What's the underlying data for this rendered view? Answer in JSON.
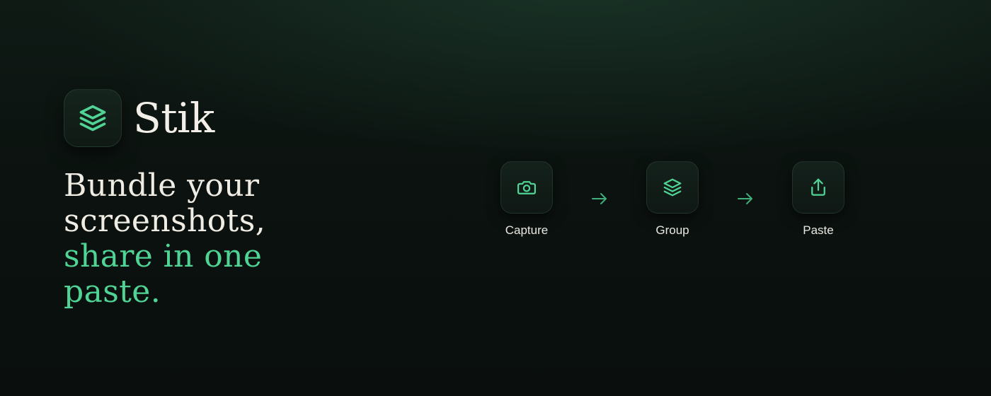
{
  "brand": {
    "name": "Stik",
    "icon": "layers-icon",
    "accent_color": "#4fd495"
  },
  "tagline": {
    "line1": "Bundle your",
    "line2": "screenshots,",
    "line3": "share in one",
    "line4": "paste."
  },
  "steps": [
    {
      "label": "Capture",
      "icon": "camera-icon"
    },
    {
      "label": "Group",
      "icon": "layers-icon"
    },
    {
      "label": "Paste",
      "icon": "share-upload-icon"
    }
  ],
  "colors": {
    "background": "#0b120f",
    "text": "#f2efe8",
    "accent": "#4fd495"
  }
}
